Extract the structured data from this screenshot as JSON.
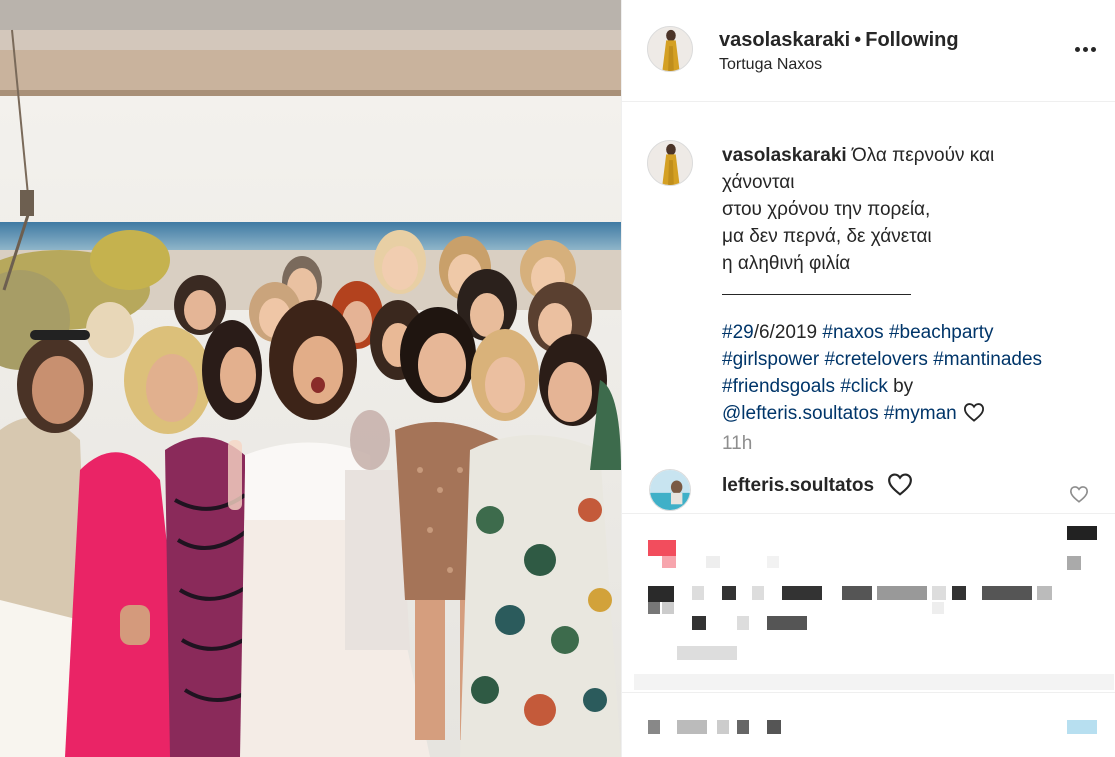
{
  "post": {
    "username": "vasolaskaraki",
    "separator": "•",
    "follow_status": "Following",
    "location": "Tortuga Naxos"
  },
  "caption": {
    "username": "vasolaskaraki",
    "lines": [
      "Όλα περνούν και",
      "χάνονται",
      "στου χρόνου την πορεία,",
      "μα δεν περνά, δε χάνεται",
      "η αληθινή φιλία"
    ],
    "tag_lines": [
      [
        "#29",
        "/6/2019 ",
        "#naxos",
        " ",
        "#beachparty"
      ],
      [
        "#girlspower",
        " ",
        "#cretelovers",
        " ",
        "#mantinades"
      ],
      [
        "#friendsgoals",
        " ",
        "#click",
        " by"
      ],
      [
        "@lefteris.soultatos",
        " ",
        "#myman"
      ]
    ],
    "time_ago": "11h"
  },
  "comment": {
    "username": "lefteris.soultatos"
  },
  "icons": {
    "more": "more-options-icon",
    "like": "heart-icon"
  },
  "colors": {
    "link": "#003569",
    "text": "#262626",
    "muted": "#8e8e8e",
    "border": "#efefef"
  }
}
